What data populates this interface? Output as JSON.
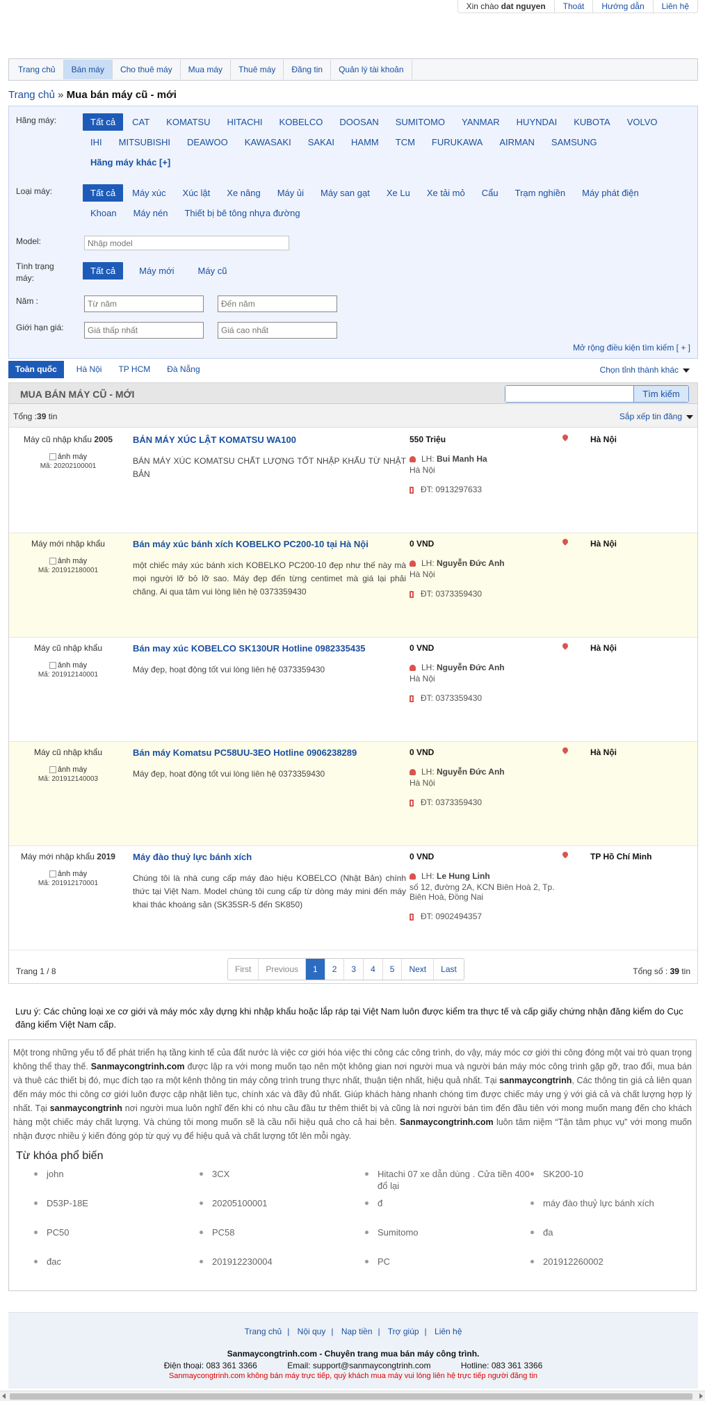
{
  "topbar": {
    "greeting_prefix": "Xin chào",
    "username": "dat nguyen",
    "logout": "Thoát",
    "guide": "Hướng dẫn",
    "contact": "Liên hệ"
  },
  "nav": [
    "Trang chủ",
    "Bán máy",
    "Cho thuê máy",
    "Mua máy",
    "Thuê máy",
    "Đăng tin",
    "Quản lý tài khoản"
  ],
  "breadcrumb": {
    "home": "Trang chủ",
    "sep": " » ",
    "current": "Mua bán máy cũ - mới"
  },
  "filter": {
    "brand_label": "Hãng máy:",
    "brands": [
      "Tất cả",
      "CAT",
      "KOMATSU",
      "HITACHI",
      "KOBELCO",
      "DOOSAN",
      "SUMITOMO",
      "YANMAR",
      "HUYNDAI",
      "KUBOTA",
      "VOLVO",
      "IHI",
      "MITSUBISHI",
      "DEAWOO",
      "KAWASAKI",
      "SAKAI",
      "HAMM",
      "TCM",
      "FURUKAWA",
      "AIRMAN",
      "SAMSUNG"
    ],
    "brand_more": "Hãng máy khác [+]",
    "type_label": "Loại máy:",
    "types": [
      "Tất cả",
      "Máy xúc",
      "Xúc lật",
      "Xe nâng",
      "Máy ủi",
      "Máy san gạt",
      "Xe Lu",
      "Xe tải mỏ",
      "Cẩu",
      "Trạm nghiền",
      "Máy phát điện",
      "Khoan",
      "Máy nén",
      "Thiết bị bê tông nhựa đường"
    ],
    "model_label": "Model:",
    "model_placeholder": "Nhập model",
    "condition_label": "Tình trạng máy:",
    "conditions": [
      "Tất cả",
      "Máy mới",
      "Máy cũ"
    ],
    "year_label": "Năm :",
    "year_from_placeholder": "Từ năm",
    "year_to_placeholder": "Đến năm",
    "price_label": "Giới hạn giá:",
    "price_min_placeholder": "Giá thấp nhất",
    "price_max_placeholder": "Giá cao nhất",
    "expand": "Mở rộng điều kiện tìm kiếm [ + ]"
  },
  "regions": [
    "Toàn quốc",
    "Hà Nội",
    "TP HCM",
    "Đà Nẵng"
  ],
  "region_choose": "Chọn tỉnh thành khác",
  "list": {
    "header": "MUA BÁN MÁY CŨ - MỚI",
    "search_button": "Tìm kiếm",
    "total_prefix": "Tổng :",
    "total_count": "39",
    "total_suffix": " tin",
    "sort": "Sắp xếp tin đăng",
    "lh_prefix": "LH: ",
    "phone_prefix": "ĐT: ",
    "img_alt": "ảnh máy",
    "items": [
      {
        "kind": "Máy cũ nhập khẩu",
        "year": "2005",
        "code": "Mã: 20202100001",
        "title": "BÁN MÁY XÚC LẬT KOMATSU WA100",
        "desc": "BÁN MÁY XÚC KOMATSU CHẤT LƯỢNG TỐT NHẬP KHẨU TỪ NHẬT BẢN",
        "price": "550 Triệu",
        "contact": "Bui Manh Ha",
        "address": "Hà Nội",
        "phone": "0913297633",
        "location": "Hà Nội"
      },
      {
        "kind": "Máy mới nhập khẩu",
        "year": "",
        "code": "Mã: 201912180001",
        "title": "Bán máy xúc bánh xích KOBELKO PC200-10 tại Hà Nội",
        "desc": "một chiếc máy xúc bánh xích KOBELKO PC200-10 đẹp như thế này mà mọi người lỡ bỏ lỡ sao. Máy đẹp đến từng centimet mà giá lại phải chăng. Ai qua tâm vui lòng liên hệ 0373359430",
        "price": "0 VND",
        "contact": "Nguyễn Đức Anh",
        "address": "Hà Nội",
        "phone": "0373359430",
        "location": "Hà Nội"
      },
      {
        "kind": "Máy cũ nhập khẩu",
        "year": "",
        "code": "Mã: 201912140001",
        "title": "Bán may xúc KOBELCO SK130UR Hotline 0982335435",
        "desc": "Máy đẹp, hoạt động tốt vui lòng liên hệ 0373359430",
        "price": "0 VND",
        "contact": "Nguyễn Đức Anh",
        "address": "Hà Nội",
        "phone": "0373359430",
        "location": "Hà Nội"
      },
      {
        "kind": "Máy cũ nhập khẩu",
        "year": "",
        "code": "Mã: 201912140003",
        "title": "Bán máy Komatsu PC58UU-3EO Hotline 0906238289",
        "desc": "Máy đẹp, hoạt động tốt vui lòng liên hệ 0373359430",
        "price": "0 VND",
        "contact": "Nguyễn Đức Anh",
        "address": "Hà Nội",
        "phone": "0373359430",
        "location": "Hà Nội"
      },
      {
        "kind": "Máy mới nhập khẩu",
        "year": "2019",
        "code": "Mã: 201912170001",
        "title": "Máy đào thuỷ lực bánh xích",
        "desc": "Chúng tôi là nhà cung cấp máy đào hiệu KOBELCO (Nhật Bản) chính thức tại Việt Nam. Model chúng tôi cung cấp từ dòng máy mini đến máy khai thác khoáng sản (SK35SR-5 đến SK850)",
        "price": "0 VND",
        "contact": "Le Hung Linh",
        "address": "số 12, đường 2A, KCN Biên Hoà 2, Tp. Biên Hoà, Đồng Nai",
        "phone": "0902494357",
        "location": "TP Hồ Chí Minh"
      }
    ]
  },
  "pager": {
    "page_info": "Trang 1 / 8",
    "buttons": [
      "First",
      "Previous",
      "1",
      "2",
      "3",
      "4",
      "5",
      "Next",
      "Last"
    ],
    "current": "1",
    "total_prefix": "Tổng số : ",
    "total": "39",
    "total_suffix": " tin"
  },
  "note": "Lưu ý: Các chủng loại xe cơ giới và máy móc xây dựng khi nhập khẩu hoặc lắp ráp tại Việt Nam luôn được kiểm tra thực tế và cấp giấy chứng nhận đăng kiểm do Cục đăng kiểm Việt Nam cấp.",
  "about": {
    "p1": "Một trong những yếu tố để phát triển hạ tầng kinh tế của đất nước là việc cơ giới hóa việc thi công các công trình, do vậy, máy móc cơ giới thi công đóng một vai trò quan trọng không thể thay thế.",
    "brand1": "Sanmaycongtrinh.com",
    "p2": "được lập ra với mong muốn tạo nên một không gian nơi người mua và người bán máy móc công trình gặp gỡ, trao đổi, mua bán và thuê các thiết bị đó, mục đích tạo ra một kênh thông tin máy công trình trung thực nhất, thuận tiện nhất, hiệu quả nhất. Tại",
    "brand2": "sanmaycongtrinh",
    "p3": ", Các thông tin giá cả liên quan đến máy móc thi công cơ giới luôn được cập nhật liên tục, chính xác và đầy đủ nhất. Giúp khách hàng nhanh chóng tìm được chiếc máy ưng ý với giá cả và chất lượng hợp lý nhất. Tại",
    "brand3": "sanmaycongtrinh",
    "p4": "nơi người mua luôn nghĩ đến khi có nhu cầu đầu tư thêm thiết bị và cũng là nơi người bán tìm đến đầu tiên với mong muốn mang đến cho khách hàng một chiếc máy chất lượng. Và chúng tôi mong muốn sẽ là cầu nối hiệu quả cho cả hai bên.",
    "brand4": "Sanmaycongtrinh.com",
    "p5": "luôn tâm niệm “Tận tâm phục vụ” với mong muốn nhận được nhiều ý kiến đóng góp từ quý vụ để hiệu quả và chất lượng tốt lên mỗi ngày.",
    "keywords_title": "Từ khóa phổ biến",
    "keywords": [
      "john",
      "3CX",
      "Hitachi 07 xe dẫn dùng . Cửa tiền 400 đổ lại",
      "SK200-10",
      "D53P-18E",
      "20205100001",
      "đ",
      "máy đào thuỷ lực bánh xích",
      "PC50",
      "PC58",
      "Sumitomo",
      "đa",
      "đac",
      "201912230004",
      "PC",
      "201912260002"
    ]
  },
  "footer": {
    "links": [
      "Trang chủ",
      "Nội quy",
      "Nạp tiền",
      "Trợ giúp",
      "Liên hệ"
    ],
    "tagline": "Sanmaycongtrinh.com - Chuyên trang mua bán máy công trình.",
    "phone": "Điện thoại: 083 361 3366",
    "email": "Email: support@sanmaycongtrinh.com",
    "hotline": "Hotline: 083 361 3366",
    "disclaimer": "Sanmaycongtrinh.com không bán máy trực tiếp, quý khách mua máy vui lòng liên hệ trực tiếp người đăng tin"
  }
}
